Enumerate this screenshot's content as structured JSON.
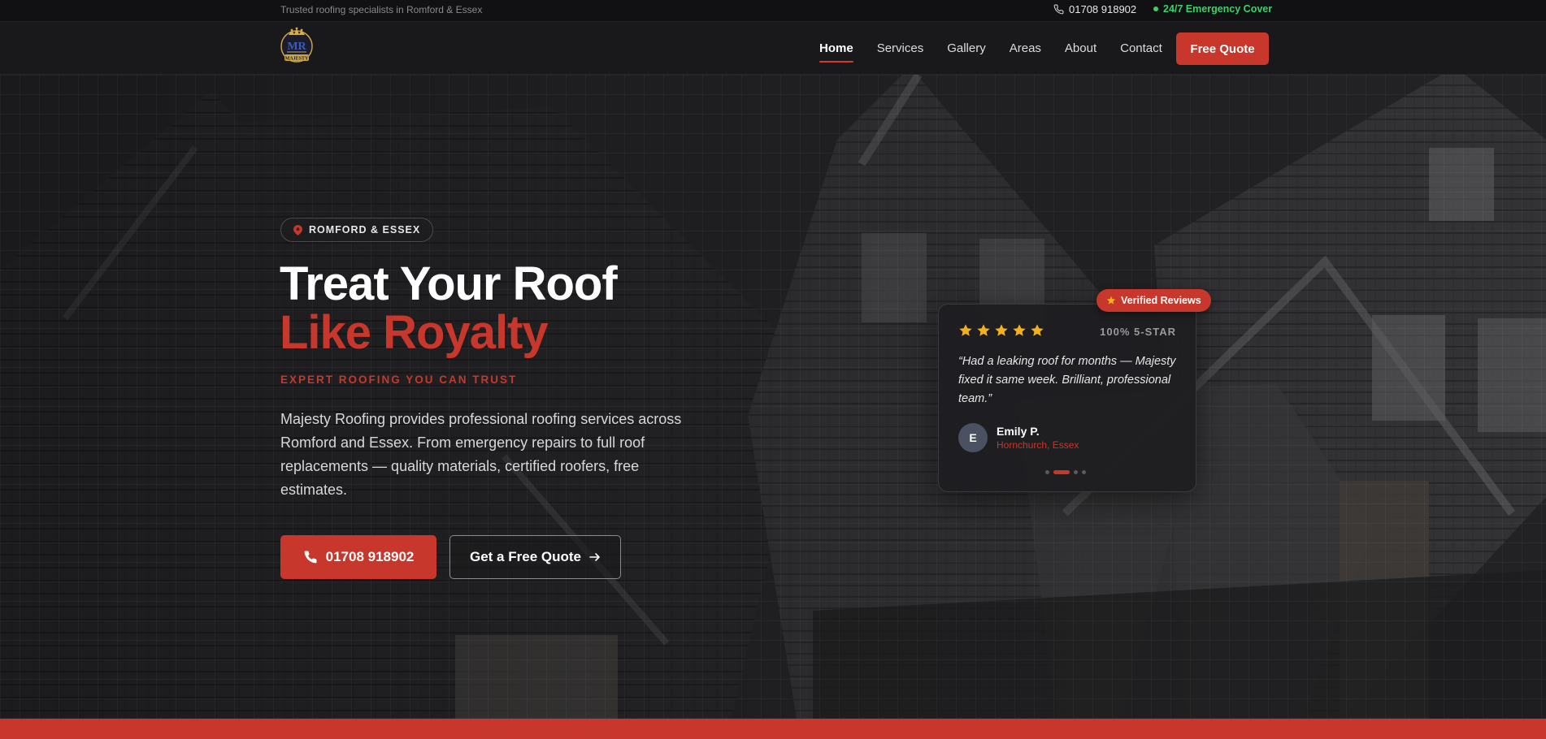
{
  "topbar": {
    "tagline": "Trusted roofing specialists in Romford & Essex",
    "phone": "01708 918902",
    "emergency": "24/7 Emergency Cover"
  },
  "nav": {
    "logo_icon": "crown-logo-icon",
    "logo_text": "MAJESTY",
    "links": [
      "Home",
      "Services",
      "Gallery",
      "Areas",
      "About",
      "Contact"
    ],
    "active": "Home",
    "cta": "Free Quote"
  },
  "hero": {
    "badge": "ROMFORD & ESSEX",
    "title_line1": "Treat Your Roof",
    "title_line2": "Like Royalty",
    "kicker": "EXPERT ROOFING YOU CAN TRUST",
    "lead": "Majesty Roofing provides professional roofing services across Romford and Essex. From emergency repairs to full roof replacements — quality materials, certified roofers, free estimates.",
    "call_button": "01708 918902",
    "quote_button": "Get a Free Quote"
  },
  "review": {
    "badge": "Verified Reviews",
    "stars": 5,
    "rating_label": "100% 5-STAR",
    "quote": "“Had a leaking roof for months — Majesty fixed it same week. Brilliant, professional team.”",
    "avatar_initial": "E",
    "name": "Emily P.",
    "location": "Hornchurch, Essex",
    "slide_count": 4,
    "active_slide": 2
  },
  "colors": {
    "accent": "#c8372b",
    "success": "#3ecf6a",
    "background": "#1b1b1d"
  }
}
